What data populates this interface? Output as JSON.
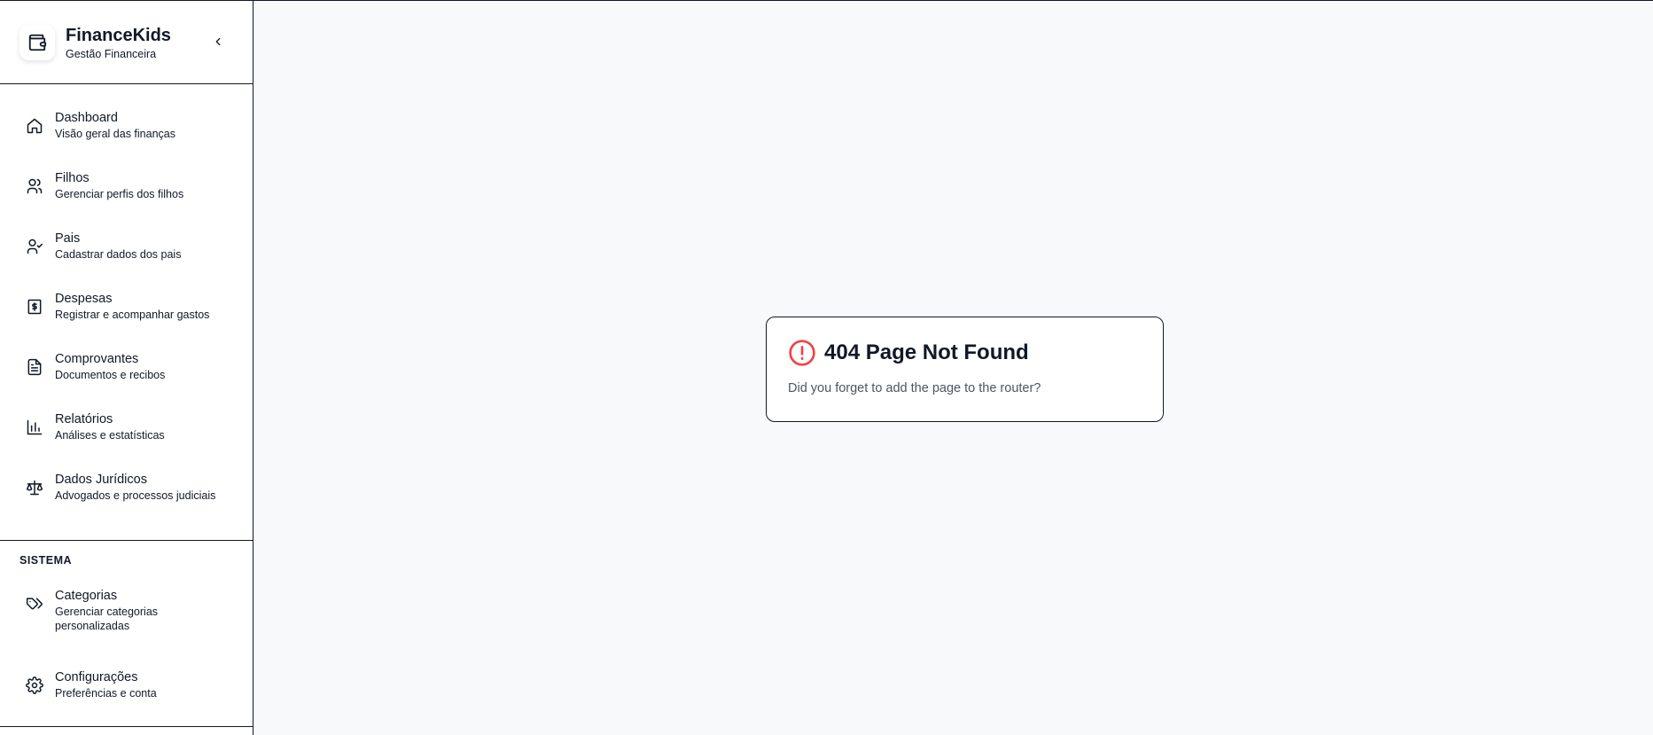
{
  "brand": {
    "title": "FinanceKids",
    "subtitle": "Gestão Financeira",
    "logo_icon": "wallet-icon",
    "collapse_icon": "chevron-left-icon"
  },
  "nav": {
    "items": [
      {
        "label": "Dashboard",
        "desc": "Visão geral das finanças",
        "icon": "home-icon"
      },
      {
        "label": "Filhos",
        "desc": "Gerenciar perfis dos filhos",
        "icon": "users-icon"
      },
      {
        "label": "Pais",
        "desc": "Cadastrar dados dos pais",
        "icon": "user-check-icon"
      },
      {
        "label": "Despesas",
        "desc": "Registrar e acompanhar gastos",
        "icon": "receipt-dollar-icon"
      },
      {
        "label": "Comprovantes",
        "desc": "Documentos e recibos",
        "icon": "file-text-icon"
      },
      {
        "label": "Relatórios",
        "desc": "Análises e estatísticas",
        "icon": "bar-chart-icon"
      },
      {
        "label": "Dados Jurídicos",
        "desc": "Advogados e processos judiciais",
        "icon": "scale-icon"
      }
    ]
  },
  "system": {
    "title": "SISTEMA",
    "items": [
      {
        "label": "Categorias",
        "desc": "Gerenciar categorias personalizadas",
        "icon": "tags-icon"
      },
      {
        "label": "Configurações",
        "desc": "Preferências e conta",
        "icon": "settings-icon"
      }
    ]
  },
  "error_card": {
    "title": "404 Page Not Found",
    "message": "Did you forget to add the page to the router?",
    "icon": "alert-circle-icon",
    "icon_color": "#ef4444"
  }
}
